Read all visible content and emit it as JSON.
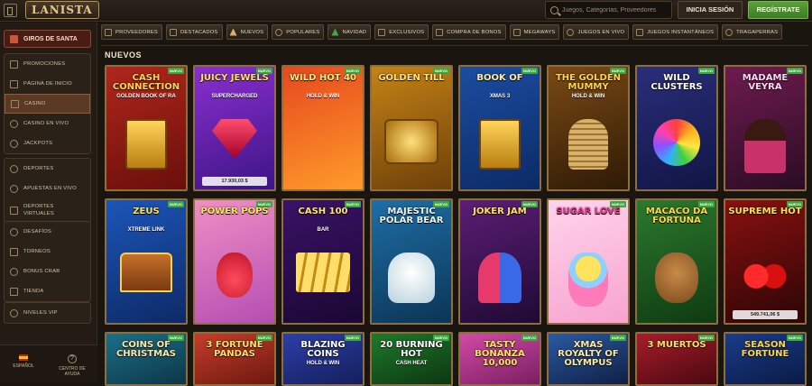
{
  "header": {
    "logo": "LANISTA",
    "search_placeholder": "Juegos, Categorías, Proveedores",
    "login_label": "INICIA SESIÓN",
    "register_label": "REGÍSTRATE"
  },
  "sidebar": {
    "promo_label": "GIROS DE SANTA",
    "group1": [
      "PROMOCIONES",
      "PÁGINA DE INICIO",
      "CASINO",
      "CASINO EN VIVO",
      "JACKPOTS"
    ],
    "group2": [
      "DEPORTES",
      "APUESTAS EN VIVO",
      "DEPORTES VIRTUALES"
    ],
    "group3": [
      "DESAFÍOS",
      "TORNEOS",
      "BONUS CRAB",
      "TIENDA"
    ],
    "group4": [
      "NIVELES VIP"
    ],
    "active": "CASINO",
    "footer": {
      "language": "ESPAÑOL",
      "help": "CENTRO DE AYUDA"
    }
  },
  "categories": [
    "PROVEEDORES",
    "DESTACADOS",
    "NUEVOS",
    "POPULARES",
    "NAVIDAD",
    "EXCLUSIVOS",
    "COMPRA DE BONOS",
    "MEGAWAYS",
    "JUEGOS EN VIVO",
    "JUEGOS INSTANTÁNEOS",
    "TRAGAPERRAS"
  ],
  "section_title": "NUEVOS",
  "badge_label": "NUEVO",
  "games": [
    {
      "title": "CASH CONNECTION",
      "sub": "GOLDEN BOOK OF RA",
      "bg": "#b0261c",
      "bg2": "#6a0f0a",
      "color": "#ffd54a",
      "art": "book"
    },
    {
      "title": "JUICY JEWELS",
      "sub": "SUPERCHARGED",
      "bg": "#8a2fd0",
      "bg2": "#3d1585",
      "color": "#ffe25c",
      "art": "gem",
      "jackpot": "17.930,03 $"
    },
    {
      "title": "WILD HOT 40",
      "sub": "HOLD & WIN",
      "bg": "#e6481e",
      "bg2": "#ff9b2a",
      "color": "#ffe97a",
      "art": "seven"
    },
    {
      "title": "GOLDEN TILL",
      "sub": "",
      "bg": "#c58316",
      "bg2": "#6e4009",
      "color": "#ffe07a",
      "art": "coins"
    },
    {
      "title": "BOOK OF",
      "sub": "XMAS 3",
      "bg": "#1b4da0",
      "bg2": "#0c2a66",
      "color": "#ffe9a8",
      "art": "book"
    },
    {
      "title": "THE GOLDEN MUMMY",
      "sub": "HOLD & WIN",
      "bg": "#7a4a14",
      "bg2": "#2e1a06",
      "color": "#ffd24a",
      "art": "mummy"
    },
    {
      "title": "WILD CLUSTERS",
      "sub": "",
      "bg": "#2a2e7a",
      "bg2": "#111544",
      "color": "#ffffff",
      "art": "wheel"
    },
    {
      "title": "MADAME VEYRA",
      "sub": "",
      "bg": "#6e1b4e",
      "bg2": "#2b0c24",
      "color": "#ffd6f4",
      "art": "lady"
    },
    {
      "title": "ZEUS",
      "sub": "XTREME LINK",
      "bg": "#1c55b8",
      "bg2": "#0d2a66",
      "color": "#ffe15a",
      "art": "chest"
    },
    {
      "title": "POWER POPS",
      "sub": "",
      "bg": "#ee8fc4",
      "bg2": "#b44fb2",
      "color": "#ffe45c",
      "art": "bear"
    },
    {
      "title": "CASH 100",
      "sub": "BAR",
      "bg": "#3a1266",
      "bg2": "#1a0833",
      "color": "#ffe36a",
      "art": "gold"
    },
    {
      "title": "MAJESTIC POLAR BEAR",
      "sub": "",
      "bg": "#1e6ea6",
      "bg2": "#0b3556",
      "color": "#e9f6ff",
      "art": "polar"
    },
    {
      "title": "JOKER JAM",
      "sub": "",
      "bg": "#5c1d76",
      "bg2": "#1e0a33",
      "color": "#ffe35c",
      "art": "jester"
    },
    {
      "title": "SUGAR LOVE",
      "sub": "",
      "bg": "#ffd4ec",
      "bg2": "#f7a3cf",
      "color": "#e4328b",
      "art": "candy"
    },
    {
      "title": "MACACO DA FORTUNA",
      "sub": "",
      "bg": "#2b7a2e",
      "bg2": "#0f3a12",
      "color": "#ffd645",
      "art": "monkey"
    },
    {
      "title": "SUPREME HOT",
      "sub": "",
      "bg": "#8a1010",
      "bg2": "#2c0505",
      "color": "#ffe24a",
      "art": "cherry",
      "jackpot": "549.741,06 $"
    },
    {
      "title": "COINS OF CHRISTMAS",
      "sub": "",
      "bg": "#1b6f8a",
      "bg2": "#0d3646",
      "color": "#ffe8a0",
      "art": ""
    },
    {
      "title": "3 FORTUNE PANDAS",
      "sub": "",
      "bg": "#c53d2a",
      "bg2": "#6d1810",
      "color": "#ffe15a",
      "art": ""
    },
    {
      "title": "BLAZING COINS",
      "sub": "HOLD & WIN",
      "bg": "#2c3fa8",
      "bg2": "#151e5c",
      "color": "#ffffff",
      "art": ""
    },
    {
      "title": "20 BURNING HOT",
      "sub": "CASH HEAT",
      "bg": "#1f7a2a",
      "bg2": "#0c3612",
      "color": "#ffffff",
      "art": ""
    },
    {
      "title": "TASTY BONANZA 10,000",
      "sub": "",
      "bg": "#d14ba6",
      "bg2": "#7b1e62",
      "color": "#ffe35c",
      "art": ""
    },
    {
      "title": "XMAS ROYALTY OF OLYMPUS",
      "sub": "",
      "bg": "#2a5aa3",
      "bg2": "#101f44",
      "color": "#ffe8a0",
      "art": ""
    },
    {
      "title": "3 MUERTOS",
      "sub": "",
      "bg": "#a71d2b",
      "bg2": "#4a0810",
      "color": "#ffe15a",
      "art": ""
    },
    {
      "title": "SEASON FORTUNE",
      "sub": "",
      "bg": "#1a3c8a",
      "bg2": "#0a1a44",
      "color": "#ffd645",
      "art": ""
    }
  ]
}
